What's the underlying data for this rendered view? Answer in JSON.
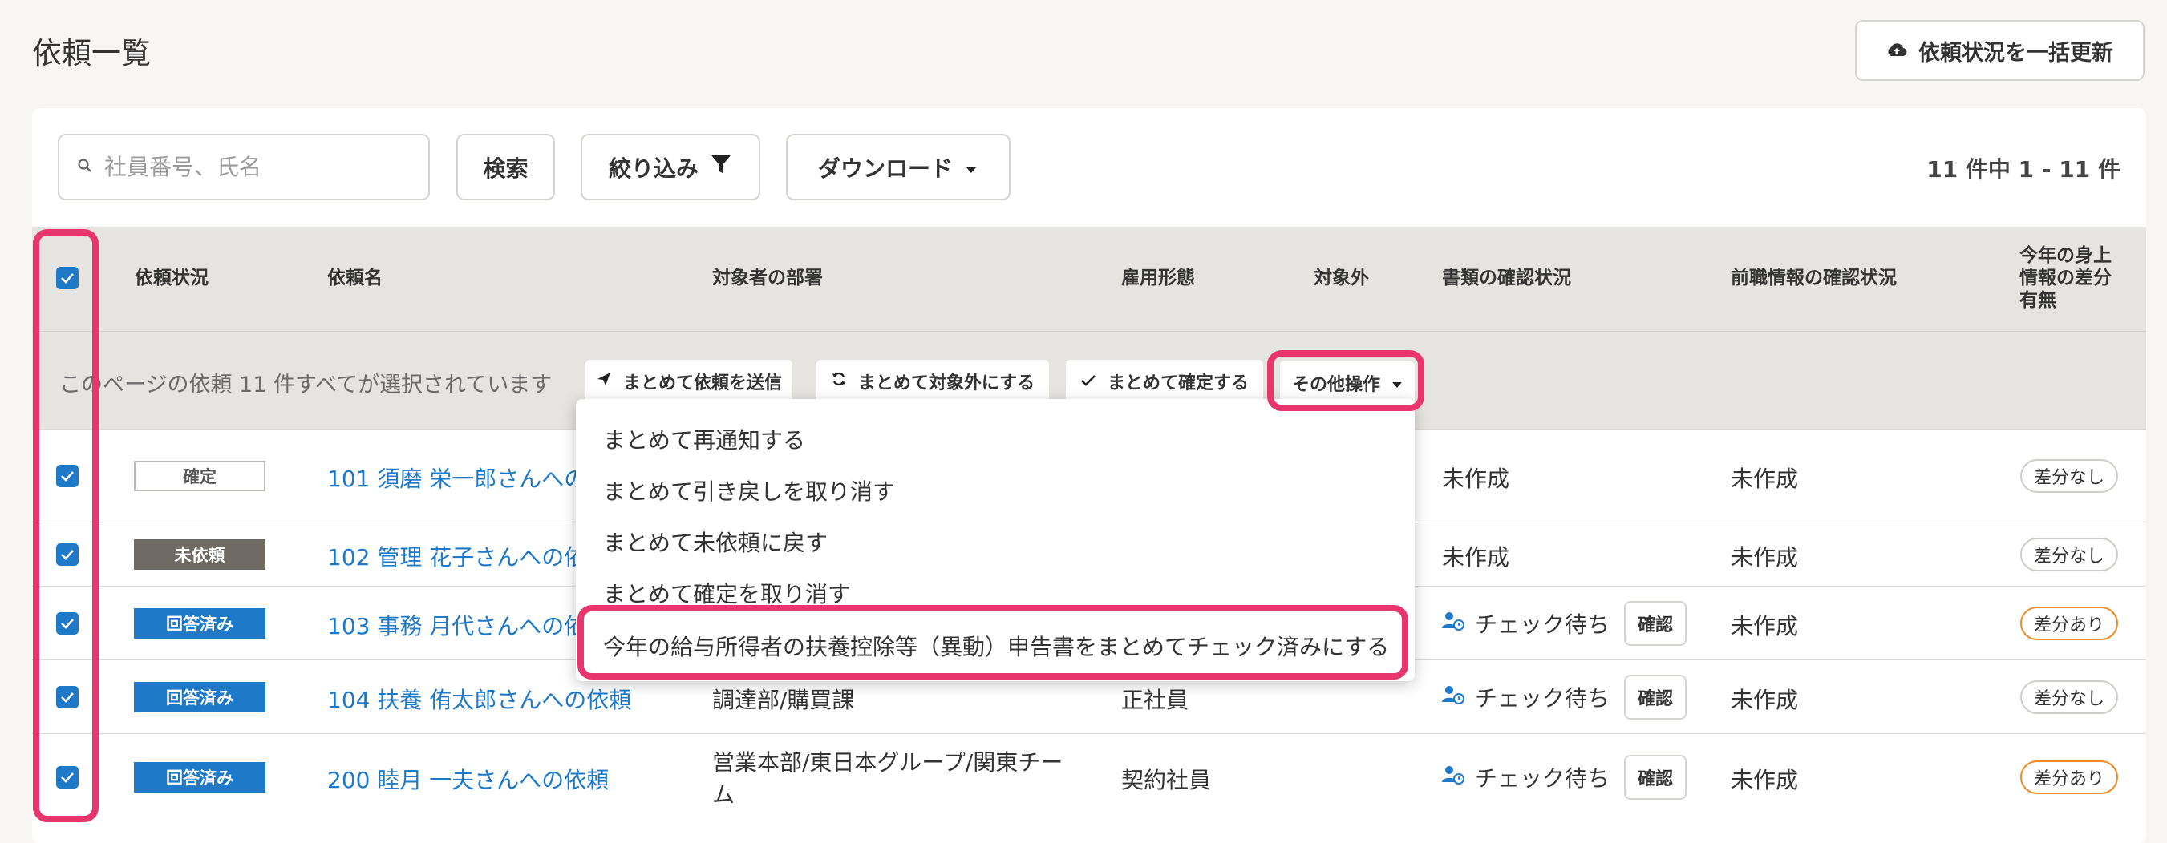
{
  "page": {
    "title": "依頼一覧",
    "bulk_update_label": "依頼状況を一括更新"
  },
  "toolbar": {
    "search_placeholder": "社員番号、氏名",
    "search_label": "検索",
    "filter_label": "絞り込み",
    "download_label": "ダウンロード",
    "count_text": "11 件中 1 - 11 件"
  },
  "table": {
    "headers": {
      "status": "依頼状況",
      "name": "依頼名",
      "dept": "対象者の部署",
      "employment": "雇用形態",
      "excluded": "対象外",
      "docs": "書類の確認状況",
      "prev_job": "前職情報の確認状況",
      "diff_line1": "今年の身上",
      "diff_line2": "情報の差分",
      "diff_line3": "有無"
    },
    "selection": {
      "message": "このページの依頼 11 件すべてが選択されています",
      "send_label": "まとめて依頼を送信",
      "exclude_label": "まとめて対象外にする",
      "confirm_label": "まとめて確定する",
      "other_label": "その他操作"
    },
    "rows": [
      {
        "status": "確定",
        "name": "101 須磨 栄一郎さんへの依頼",
        "dept": "",
        "employment": "",
        "docs": "未作成",
        "prev": "未作成",
        "diff": "差分なし"
      },
      {
        "status": "未依頼",
        "name": "102 管理 花子さんへの依頼",
        "dept": "",
        "employment": "",
        "docs": "未作成",
        "prev": "未作成",
        "diff": "差分なし"
      },
      {
        "status": "回答済み",
        "name": "103 事務 月代さんへの依頼",
        "dept": "",
        "employment": "",
        "docs": "チェック待ち",
        "docs_button": "確認",
        "prev": "未作成",
        "diff": "差分あり"
      },
      {
        "status": "回答済み",
        "name": "104 扶養 侑太郎さんへの依頼",
        "dept": "調達部/購買課",
        "employment": "正社員",
        "docs": "チェック待ち",
        "docs_button": "確認",
        "prev": "未作成",
        "diff": "差分なし"
      },
      {
        "status": "回答済み",
        "name": "200 睦月 一夫さんへの依頼",
        "dept_line1": "営業本部/東日本グループ/関東チー",
        "dept_line2": "ム",
        "employment": "契約社員",
        "docs": "チェック待ち",
        "docs_button": "確認",
        "prev": "未作成",
        "diff": "差分あり"
      }
    ]
  },
  "other_menu": {
    "items": [
      "まとめて再通知する",
      "まとめて引き戻しを取り消す",
      "まとめて未依頼に戻す",
      "まとめて確定を取り消す",
      "今年の給与所得者の扶養控除等（異動）申告書をまとめてチェック済みにする"
    ]
  },
  "colors": {
    "accent": "#1e79c8",
    "highlight": "#e8356d",
    "diff_border": "#f08a24",
    "unrequested": "#6f6a64"
  }
}
